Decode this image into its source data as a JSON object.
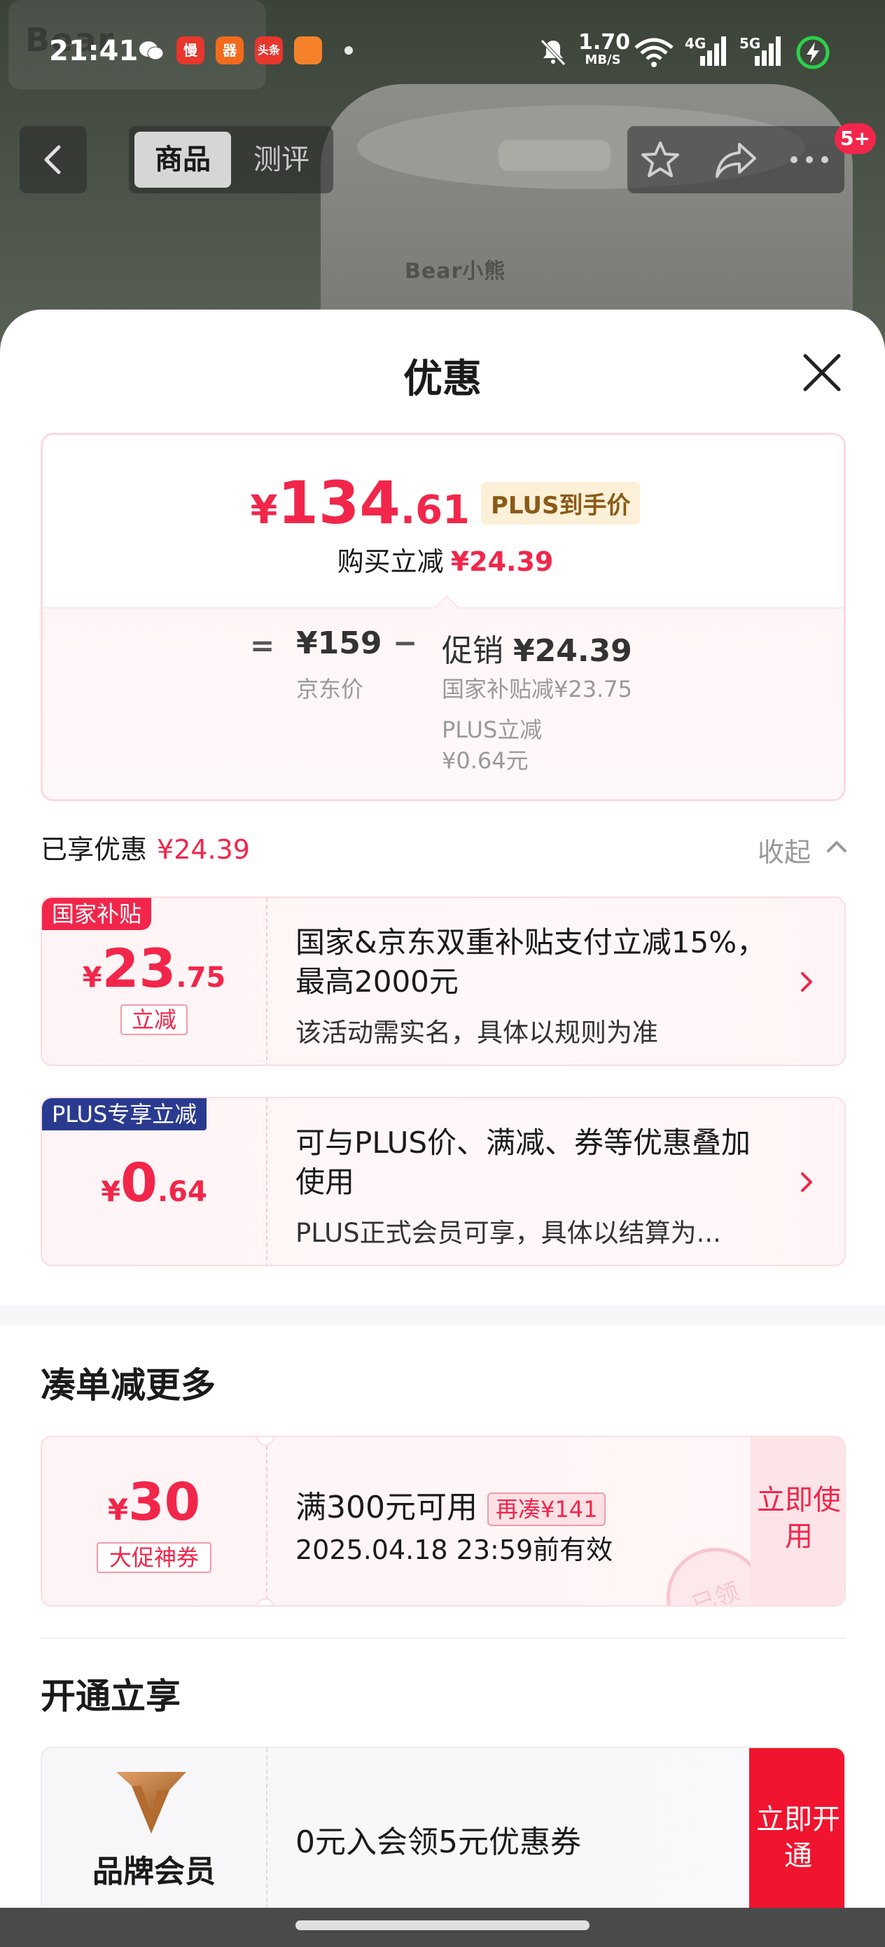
{
  "status_bar": {
    "time": "21:41",
    "apps": [
      "慢",
      "器",
      "头条"
    ],
    "net_speed_value": "1.70",
    "net_speed_unit": "MB/S",
    "cell1": "4G",
    "cell2": "5G",
    "background_watermark": "Bear"
  },
  "nav": {
    "tab_active": "商品",
    "tab_inactive": "测评",
    "badge": "5+"
  },
  "product": {
    "brand_text": "Bear小熊"
  },
  "sheet": {
    "title": "优惠"
  },
  "price_summary": {
    "yen": "¥",
    "integer": "134",
    "decimal": ".61",
    "plus_label": "PLUS到手价",
    "instant_label": "购买立减",
    "instant_amount": "¥24.39",
    "eq": "=",
    "jd_price": "¥159",
    "jd_price_label": "京东价",
    "minus": "−",
    "promo_label": "促销",
    "promo_amount": "¥24.39",
    "subsidy_line": "国家补贴减¥23.75",
    "plus_reduce_label": "PLUS立减",
    "plus_reduce_amount": "¥0.64元"
  },
  "enjoyed": {
    "label": "已享优惠",
    "amount": "¥24.39",
    "collapse_label": "收起"
  },
  "discounts": [
    {
      "tag": "国家补贴",
      "tag_color": "#f2264a",
      "yen": "¥",
      "int": "23",
      "dec": ".75",
      "badge": "立减",
      "title": "国家&京东双重补贴支付立减15%，最高2000元",
      "desc": "该活动需实名，具体以规则为准"
    },
    {
      "tag": "PLUS专享立减",
      "tag_color": "#2a3a8f",
      "yen": "¥",
      "int": "0",
      "dec": ".64",
      "title": "可与PLUS价、满减、券等优惠叠加使用",
      "desc": "PLUS正式会员可享，具体以结算为..."
    }
  ],
  "bundle": {
    "section_title": "凑单减更多",
    "yen": "¥",
    "amount": "30",
    "badge": "大促神券",
    "condition": "满300元可用",
    "extra": "再凑¥141",
    "expiry": "2025.04.18 23:59前有效",
    "stamp": "已领",
    "cta": "立即使用"
  },
  "membership": {
    "section_title": "开通立享",
    "brand_label": "品牌会员",
    "offer": "0元入会领5元优惠券",
    "cta": "立即开通"
  },
  "colors": {
    "accent_red": "#f2264a",
    "plus_gold": "#8a5a17",
    "plus_navy": "#2a3a8f"
  }
}
